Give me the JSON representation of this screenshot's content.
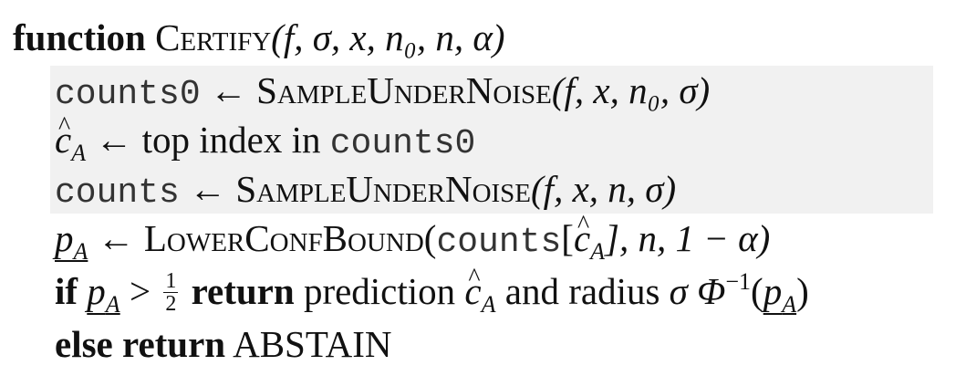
{
  "func_keyword": "function",
  "func_name": "Certify",
  "func_args": "(f, σ, x, n₀, n, α)",
  "lines": {
    "l1_var": "counts0",
    "l1_arrow": " ← ",
    "l1_fn": "SampleUnderNoise",
    "l1_args": "(f, x, n₀, σ)",
    "l2_var": "c",
    "l2_sub": "A",
    "l2_arrow": " ← ",
    "l2_text": "top index in ",
    "l2_mono": "counts0",
    "l3_var": "counts",
    "l3_arrow": " ← ",
    "l3_fn": "SampleUnderNoise",
    "l3_args": "(f, x, n, σ)",
    "l4_var": "p",
    "l4_sub": "A",
    "l4_arrow": " ← ",
    "l4_fn": "LowerConfBound",
    "l4_open": "(",
    "l4_mono": "counts",
    "l4_bracket_open": "[",
    "l4_c": "c",
    "l4_c_sub": "A",
    "l4_rest": "], n, 1 − α)",
    "l5_if": "if",
    "l5_p": "p",
    "l5_p_sub": "A",
    "l5_gt": " > ",
    "l5_num": "1",
    "l5_den": "2",
    "l5_return": "return",
    "l5_text1": " prediction ",
    "l5_c": "c",
    "l5_c_sub": "A",
    "l5_text2": " and radius ",
    "l5_sigma": "σ Φ",
    "l5_sup": "−1",
    "l5_open": "(",
    "l5_p2": "p",
    "l5_p2_sub": "A",
    "l5_close": ")",
    "l6_kw": "else return",
    "l6_text": " ABSTAIN"
  }
}
